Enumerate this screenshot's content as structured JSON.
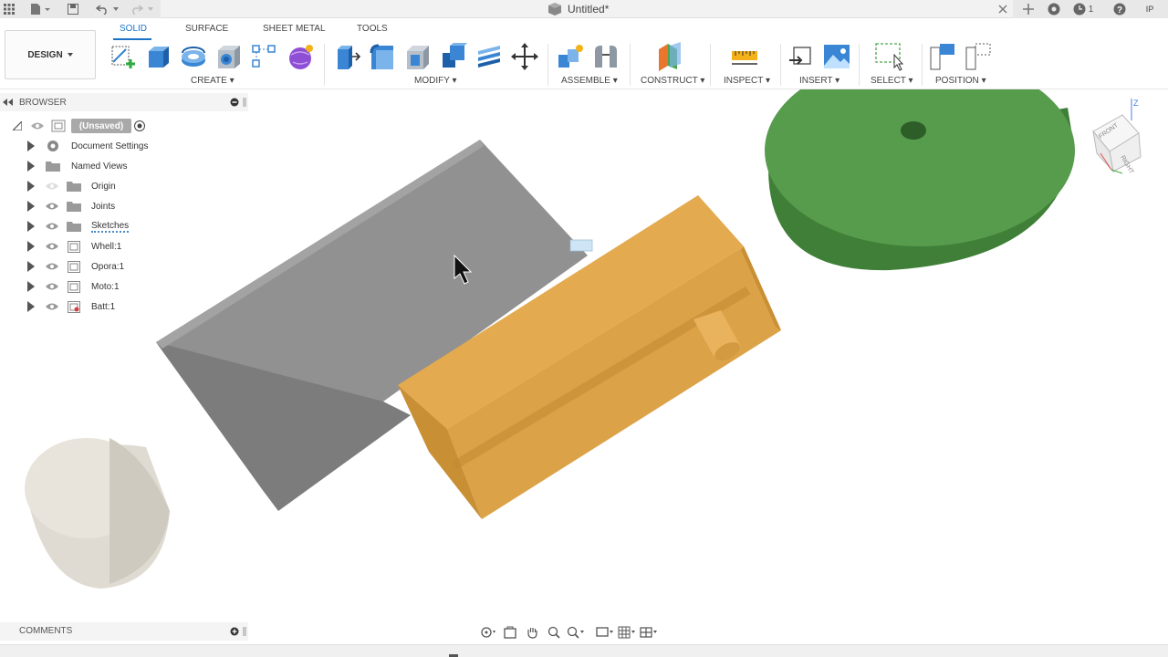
{
  "app": {
    "doc_title": "Untitled*",
    "notifications_count": "1",
    "user_initials": "IP"
  },
  "ribbon": {
    "workspace": "DESIGN",
    "tabs": [
      "SOLID",
      "SURFACE",
      "SHEET METAL",
      "TOOLS"
    ],
    "groups": [
      "CREATE",
      "MODIFY",
      "ASSEMBLE",
      "CONSTRUCT",
      "INSPECT",
      "INSERT",
      "SELECT",
      "POSITION"
    ]
  },
  "browser": {
    "title": "BROWSER",
    "root": "(Unsaved)",
    "items": [
      {
        "label": "Document Settings",
        "icon": "gear-icon"
      },
      {
        "label": "Named Views",
        "icon": "folder-icon"
      },
      {
        "label": "Origin",
        "icon": "folder-icon"
      },
      {
        "label": "Joints",
        "icon": "folder-icon"
      },
      {
        "label": "Sketches",
        "icon": "folder-icon"
      },
      {
        "label": "Whell:1",
        "icon": "component-icon"
      },
      {
        "label": "Opora:1",
        "icon": "component-icon"
      },
      {
        "label": "Moto:1",
        "icon": "component-icon"
      },
      {
        "label": "Batt:1",
        "icon": "component-icon"
      }
    ]
  },
  "viewcube": {
    "front": "FRONT",
    "right": "RIGHT",
    "axis": "Z"
  },
  "bottom": {
    "comments": "COMMENTS"
  },
  "colors": {
    "accent": "#1a73c8",
    "gray_body": "#8d8d8d",
    "orange_body": "#e0a548",
    "green_body": "#4f8f45",
    "white_body": "#e2dfd8"
  }
}
